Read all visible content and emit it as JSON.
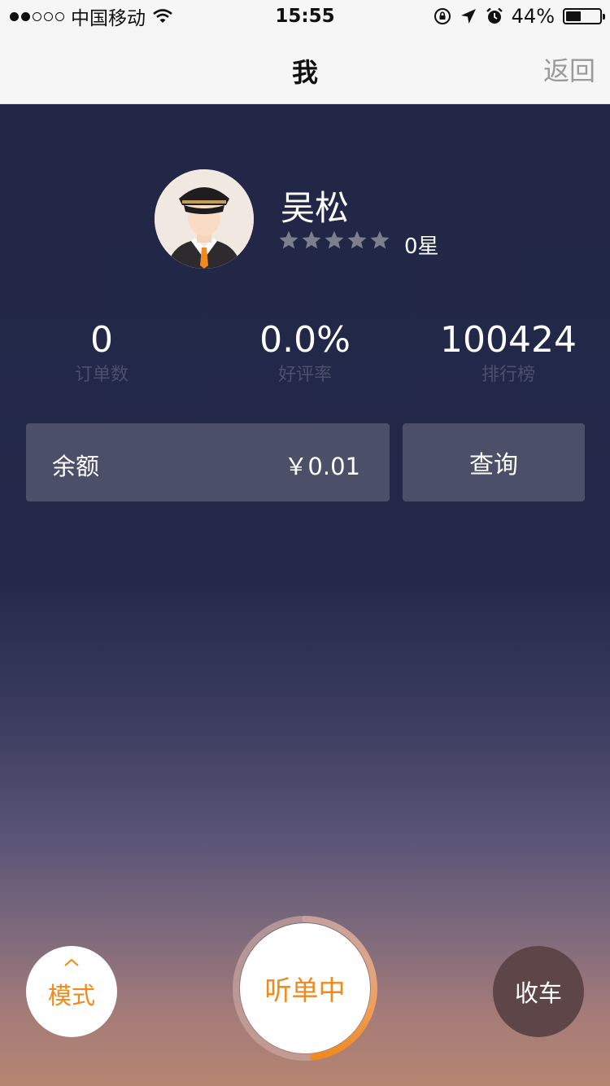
{
  "status_bar": {
    "carrier": "中国移动",
    "time": "15:55",
    "battery_percent": "44%",
    "battery_level": 0.44,
    "signal_bars": 2,
    "signal_total": 5
  },
  "nav": {
    "title": "我",
    "back_label": "返回"
  },
  "profile": {
    "name": "吴松",
    "stars_total": 5,
    "star_rating_label": "0星",
    "avatar_icon": "driver-avatar"
  },
  "stats": [
    {
      "value": "0",
      "label": "订单数"
    },
    {
      "value": "0.0%",
      "label": "好评率"
    },
    {
      "value": "100424",
      "label": "排行榜"
    }
  ],
  "balance": {
    "label": "余额",
    "amount": "￥0.01"
  },
  "query_button": {
    "label": "查询"
  },
  "bottom": {
    "mode_label": "模式",
    "listen_label": "听单中",
    "stop_label": "收车"
  },
  "colors": {
    "accent": "#f08a1c",
    "panel": "#4b5068",
    "stop_bg": "#5e4648"
  }
}
